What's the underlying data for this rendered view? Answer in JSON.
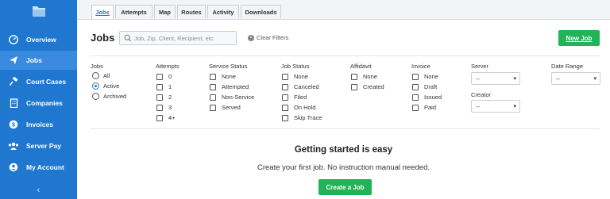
{
  "sidebar": {
    "items": [
      {
        "label": "Overview",
        "icon": "dashboard-icon"
      },
      {
        "label": "Jobs",
        "icon": "paper-plane-icon",
        "active": true
      },
      {
        "label": "Court Cases",
        "icon": "gavel-icon"
      },
      {
        "label": "Companies",
        "icon": "building-icon"
      },
      {
        "label": "Invoices",
        "icon": "dollar-icon"
      },
      {
        "label": "Server Pay",
        "icon": "users-icon"
      },
      {
        "label": "My Account",
        "icon": "user-icon"
      }
    ],
    "collapse_glyph": "‹"
  },
  "tabs": {
    "jobs": "Jobs",
    "attempts": "Attempts",
    "map": "Map",
    "routes": "Routes",
    "activity": "Activity",
    "downloads": "Downloads"
  },
  "header": {
    "title": "Jobs",
    "search_placeholder": "Job, Zip, Client, Recipient, etc.",
    "clear_filters": "Clear Filters",
    "new_job": "New Job"
  },
  "filters": {
    "jobs": {
      "title": "Jobs",
      "options": [
        "All",
        "Active",
        "Archived"
      ],
      "selected": "Active"
    },
    "attempts": {
      "title": "Attempts",
      "options": [
        "0",
        "1",
        "2",
        "3",
        "4+"
      ]
    },
    "service_status": {
      "title": "Service Status",
      "options": [
        "None",
        "Attempted",
        "Non-Service",
        "Served"
      ]
    },
    "job_status": {
      "title": "Job Status",
      "options": [
        "None",
        "Canceled",
        "Filed",
        "On Hold",
        "Skip Trace"
      ]
    },
    "affidavit": {
      "title": "Affidavit",
      "options": [
        "None",
        "Created"
      ]
    },
    "invoice": {
      "title": "Invoice",
      "options": [
        "None",
        "Draft",
        "Issued",
        "Paid"
      ]
    },
    "server": {
      "title": "Server",
      "value": "--"
    },
    "creator": {
      "title": "Creator",
      "value": "--"
    },
    "date_range": {
      "title": "Date Range",
      "value": "--"
    }
  },
  "empty_state": {
    "title": "Getting started is easy",
    "subtitle": "Create your first job. No instruction manual needed.",
    "button": "Create a Job"
  },
  "colors": {
    "sidebar": "#1f77d0",
    "accent_green": "#20b358",
    "active_tab": "#1f77d0"
  }
}
